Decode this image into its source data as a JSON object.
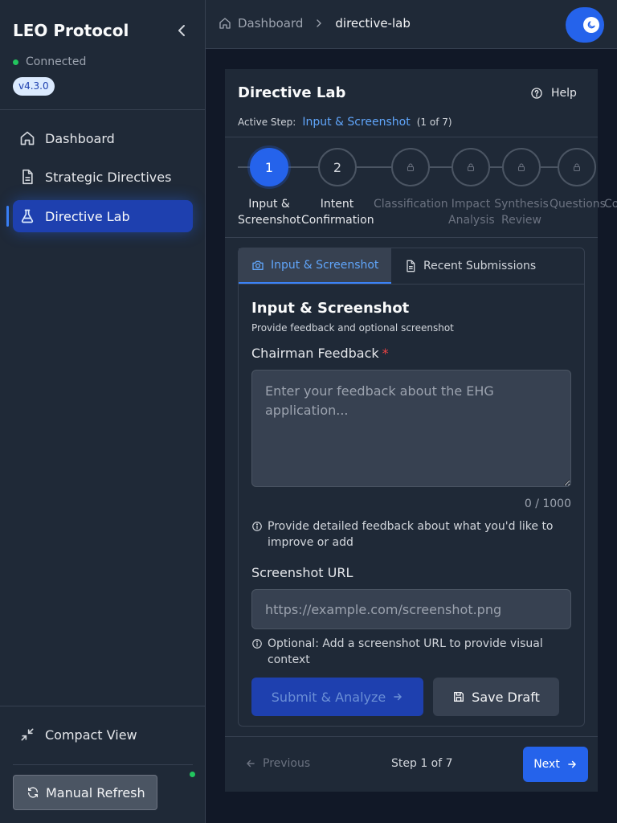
{
  "sidebar": {
    "brand": "LEO Protocol",
    "status": "Connected",
    "version": "v4.3.0",
    "nav": [
      {
        "label": "Dashboard",
        "icon": "home-icon"
      },
      {
        "label": "Strategic Directives",
        "icon": "document-icon"
      },
      {
        "label": "Directive Lab",
        "icon": "flask-icon",
        "active": true
      }
    ],
    "compact_label": "Compact View",
    "refresh_label": "Manual Refresh"
  },
  "header": {
    "breadcrumb": [
      "Dashboard",
      "directive-lab"
    ]
  },
  "lab": {
    "title": "Directive Lab",
    "help": "Help",
    "active_step_label": "Active Step:",
    "active_step_name": "Input & Screenshot",
    "active_step_count": "(1 of 7)",
    "steps": [
      {
        "number": "1",
        "label_line1": "Input &",
        "label_line2": "Screenshot",
        "state": "active"
      },
      {
        "number": "2",
        "label_line1": "Intent",
        "label_line2": "Confirmation",
        "state": "available"
      },
      {
        "number": "",
        "label_line1": "Classification",
        "label_line2": "",
        "state": "locked"
      },
      {
        "number": "",
        "label_line1": "Impact",
        "label_line2": "Analysis",
        "state": "locked"
      },
      {
        "number": "",
        "label_line1": "Synthesis",
        "label_line2": "Review",
        "state": "locked"
      },
      {
        "number": "",
        "label_line1": "Questions",
        "label_line2": "",
        "state": "locked"
      },
      {
        "number": "",
        "label_line1": "Co",
        "label_line2": "",
        "state": "locked"
      }
    ],
    "tabs": [
      "Input & Screenshot",
      "Recent Submissions"
    ],
    "section_title": "Input & Screenshot",
    "section_subtitle": "Provide feedback and optional screenshot",
    "feedback_label": "Chairman Feedback",
    "required_mark": "*",
    "feedback_value": "",
    "feedback_placeholder": "Enter your feedback about the EHG application...",
    "char_count": "0 / 1000",
    "feedback_hint": "Provide detailed feedback about what you'd like to improve or add",
    "screenshot_label": "Screenshot URL",
    "screenshot_value": "",
    "screenshot_placeholder": "https://example.com/screenshot.png",
    "screenshot_hint": "Optional: Add a screenshot URL to provide visual context",
    "submit_label": "Submit & Analyze",
    "draft_label": "Save Draft",
    "prev_label": "Previous",
    "step_indicator": "Step 1 of 7",
    "next_label": "Next"
  },
  "colors": {
    "accent": "#2563eb",
    "sidebar_bg": "#1f2937",
    "page_bg": "#111827",
    "status_green": "#22c55e",
    "link_blue": "#60a5fa",
    "required_red": "#ef4444"
  }
}
